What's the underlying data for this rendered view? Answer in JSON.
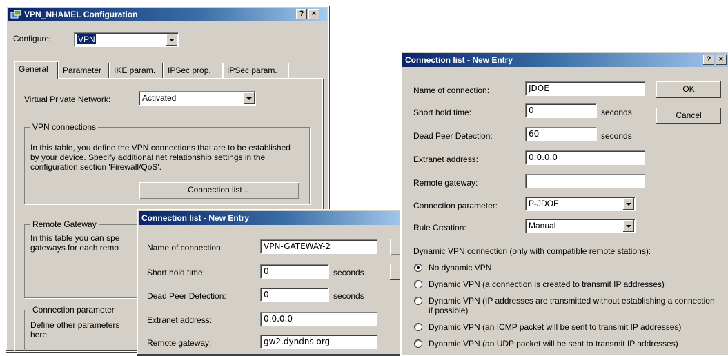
{
  "win1": {
    "title": "VPN_NHAMEL Configuration",
    "help_btn": "?",
    "close_btn": "×",
    "configure_label": "Configure:",
    "configure_value": "VPN",
    "tabs": [
      {
        "label": "General"
      },
      {
        "label": "Parameter"
      },
      {
        "label": "IKE param."
      },
      {
        "label": "IPSec prop."
      },
      {
        "label": "IPSec param."
      }
    ],
    "vpn_label": "Virtual Private Network:",
    "vpn_value": "Activated",
    "vpn_connections": {
      "title": "VPN connections",
      "text": "In this table, you define the VPN connections that are to be established by your device. Specify additional net relationship settings in the configuration section 'Firewall/QoS'.",
      "button": "Connection list ..."
    },
    "remote_gateway": {
      "title": "Remote Gateway",
      "text": "In this table you can spe gateways for each remo"
    },
    "connection_parameter": {
      "title": "Connection parameter",
      "text": "Define other parameters here."
    }
  },
  "win2": {
    "title": "Connection list - New Entry",
    "name_label": "Name of connection:",
    "name_value": "VPN-GATEWAY-2",
    "short_hold_label": "Short hold time:",
    "short_hold_value": "0",
    "short_hold_unit": "seconds",
    "dpd_label": "Dead Peer Detection:",
    "dpd_value": "0",
    "dpd_unit": "seconds",
    "extranet_label": "Extranet address:",
    "extranet_value": "0.0.0.0",
    "remote_gw_label": "Remote gateway:",
    "remote_gw_value": "gw2.dyndns.org"
  },
  "win3": {
    "title": "Connection list - New Entry",
    "help_btn": "?",
    "close_btn": "×",
    "name_label": "Name of connection:",
    "name_value": "JDOE",
    "ok": "OK",
    "cancel": "Cancel",
    "short_hold_label": "Short hold time:",
    "short_hold_value": "0",
    "short_hold_unit": "seconds",
    "dpd_label": "Dead Peer Detection:",
    "dpd_value": "60",
    "dpd_unit": "seconds",
    "extranet_label": "Extranet address:",
    "extranet_value": "0.0.0.0",
    "remote_gw_label": "Remote gateway:",
    "remote_gw_value": "",
    "conn_param_label": "Connection parameter:",
    "conn_param_value": "P-JDOE",
    "rule_label": "Rule Creation:",
    "rule_value": "Manual",
    "dynamic_heading": "Dynamic VPN connection (only with compatible remote stations):",
    "radios": [
      {
        "label": "No dynamic VPN",
        "selected": true
      },
      {
        "label": "Dynamic VPN (a connection is created to transmit IP addresses)",
        "selected": false
      },
      {
        "label": "Dynamic VPN (IP addresses are transmitted without establishing a connection if possible)",
        "selected": false
      },
      {
        "label": "Dynamic VPN (an ICMP packet will be sent to transmit IP addresses)",
        "selected": false
      },
      {
        "label": "Dynamic VPN (an UDP packet will be sent to transmit IP addresses)",
        "selected": false
      }
    ]
  }
}
